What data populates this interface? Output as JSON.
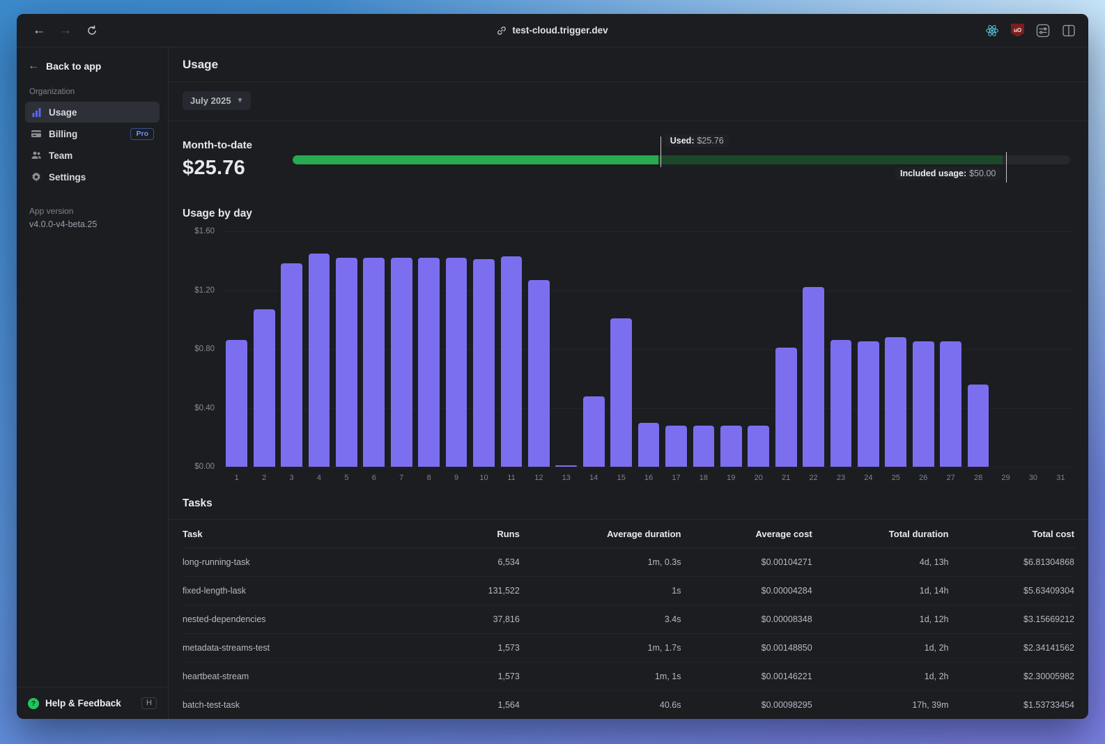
{
  "browser": {
    "url": "test-cloud.trigger.dev",
    "shield_text": "uO"
  },
  "sidebar": {
    "back_label": "Back to app",
    "section_label": "Organization",
    "items": [
      {
        "label": "Usage",
        "icon": "bar-chart-icon",
        "active": true
      },
      {
        "label": "Billing",
        "icon": "credit-card-icon",
        "badge": "Pro"
      },
      {
        "label": "Team",
        "icon": "users-icon"
      },
      {
        "label": "Settings",
        "icon": "gear-icon"
      }
    ],
    "app_version_label": "App version",
    "app_version_value": "v4.0.0-v4-beta.25",
    "help_label": "Help & Feedback",
    "help_shortcut": "H",
    "help_icon_glyph": "?"
  },
  "header": {
    "title": "Usage"
  },
  "period": {
    "selected": "July 2025"
  },
  "month_to_date": {
    "label": "Month-to-date",
    "amount": "$25.76",
    "used_label": "Used:",
    "used_value": "$25.76",
    "included_label": "Included usage:",
    "included_value": "$50.00",
    "used_amount": 25.76,
    "included_amount": 50.0,
    "included_pct_of_track": 91.3,
    "colors": {
      "used": "#27aa50",
      "included_remainder": "#1d4729",
      "track": "#26282d"
    }
  },
  "chart_data": {
    "type": "bar",
    "title": "Usage by day",
    "categories": [
      "1",
      "2",
      "3",
      "4",
      "5",
      "6",
      "7",
      "8",
      "9",
      "10",
      "11",
      "12",
      "13",
      "14",
      "15",
      "16",
      "17",
      "18",
      "19",
      "20",
      "21",
      "22",
      "23",
      "24",
      "25",
      "26",
      "27",
      "28",
      "29",
      "30",
      "31"
    ],
    "values": [
      0.86,
      1.07,
      1.38,
      1.45,
      1.42,
      1.42,
      1.42,
      1.42,
      1.42,
      1.41,
      1.43,
      1.27,
      0.01,
      0.48,
      1.01,
      0.3,
      0.28,
      0.28,
      0.28,
      0.28,
      0.81,
      1.22,
      0.86,
      0.85,
      0.88,
      0.85,
      0.85,
      0.56,
      0,
      0,
      0
    ],
    "ytick_labels": [
      "$0.00",
      "$0.40",
      "$0.80",
      "$1.20",
      "$1.60"
    ],
    "ylim": [
      0,
      1.6
    ],
    "grid": true,
    "bar_color": "#7b6ff0"
  },
  "tasks": {
    "title": "Tasks",
    "columns": [
      "Task",
      "Runs",
      "Average duration",
      "Average cost",
      "Total duration",
      "Total cost"
    ],
    "rows": [
      [
        "long-running-task",
        "6,534",
        "1m, 0.3s",
        "$0.00104271",
        "4d, 13h",
        "$6.81304868"
      ],
      [
        "fixed-length-lask",
        "131,522",
        "1s",
        "$0.00004284",
        "1d, 14h",
        "$5.63409304"
      ],
      [
        "nested-dependencies",
        "37,816",
        "3.4s",
        "$0.00008348",
        "1d, 12h",
        "$3.15669212"
      ],
      [
        "metadata-streams-test",
        "1,573",
        "1m, 1.7s",
        "$0.00148850",
        "1d, 2h",
        "$2.34141562"
      ],
      [
        "heartbeat-stream",
        "1,573",
        "1m, 1s",
        "$0.00146221",
        "1d, 2h",
        "$2.30005982"
      ],
      [
        "batch-test-task",
        "1,564",
        "40.6s",
        "$0.00098295",
        "17h, 39m",
        "$1.53733454"
      ]
    ]
  }
}
